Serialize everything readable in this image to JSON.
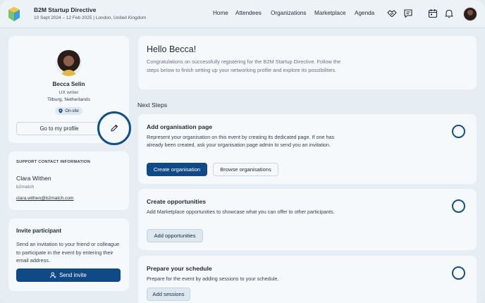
{
  "header": {
    "event_title": "B2M Startup Directive",
    "event_subtitle": "10 Sept 2024 – 12 Feb 2025 | London, United Kingdom",
    "nav": [
      "Home",
      "Attendees",
      "Organizations",
      "Marketplace",
      "Agenda"
    ],
    "icons": [
      "handshake-icon",
      "chat-icon",
      "calendar-icon",
      "bell-icon"
    ]
  },
  "profile": {
    "name": "Becca Selin",
    "role": "UX writer",
    "location": "Tilburg, Netherlands",
    "attendance_badge": "On-site",
    "profile_button": "Go to my profile"
  },
  "support": {
    "heading": "SUPPORT CONTACT INFORMATION",
    "name": "Clara Withen",
    "organization": "b2match",
    "email": "clara.withen@b2match.com"
  },
  "invite": {
    "title": "Invite participant",
    "text": "Send an invitation to your friend or colleague to participate in the event by entering their email address.",
    "button": "Send invite"
  },
  "welcome": {
    "title": "Hello Becca!",
    "text": "Congratulations on successfully registering for the B2M Startup Directive. Follow the steps below to finish setting up your networking profile and explore its possibilities."
  },
  "next_steps_label": "Next Steps",
  "steps": [
    {
      "title": "Add organisation page",
      "text": "Represent your organisation on this event by creating its dedicated page. If one has already been created, ask your organisation page admin to send you an invitation.",
      "primary_button": "Create organisation",
      "secondary_button": "Browse organisations"
    },
    {
      "title": "Create opportunities",
      "text": "Add Marketplace opportunities to showcase what you can offer to other participants.",
      "button": "Add opportunities"
    },
    {
      "title": "Prepare your schedule",
      "text": "Prepare for the event by adding sessions to your schedule.",
      "button": "Add sessions"
    }
  ],
  "colors": {
    "primary": "#0f4a86",
    "background": "#e6edf3",
    "card": "#f6f9fb"
  }
}
